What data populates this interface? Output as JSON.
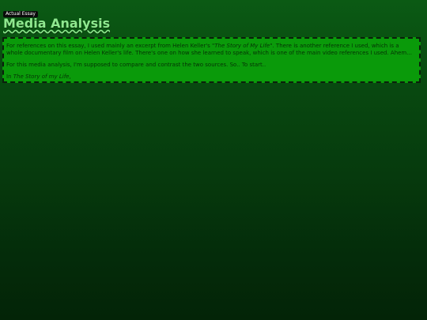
{
  "tabs": {
    "active_label": "Actual Essay"
  },
  "page": {
    "title": "Media Analysis"
  },
  "essay": {
    "p1_a": "For references on this essay, I used mainly an excerpt from Helen Keller's \"",
    "p1_title": "The Story of My Life",
    "p1_b": "\". There is another reference I used, which is a whole documentary film on Helen Keller's life. There's one on how she learned to speak, which is one of the main video references I used. Ahem...",
    "p2": "For this media analysis, I'm supposed to compare and contrast the two sources. So.. To start..",
    "p3_a": "In ",
    "p3_title": "The Story of my Life",
    "p3_b": ","
  },
  "colors": {
    "background_top": "#0b5a14",
    "background_bottom": "#032407",
    "title": "#8fe88f",
    "box_fill": "#0a9a0a",
    "box_border": "#0b1f0b",
    "tab": "#0b0b0b"
  }
}
